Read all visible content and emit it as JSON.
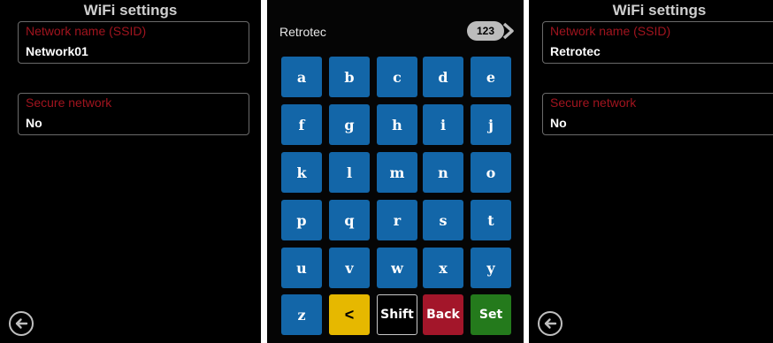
{
  "colors": {
    "panel_bg": "#000000",
    "label_red": "#a0141e",
    "key_blue": "#1366a8",
    "key_yellow": "#e6b800",
    "key_red": "#a3162a",
    "key_green": "#247a1c"
  },
  "left_screen": {
    "title": "WiFi settings",
    "ssid_label": "Network name (SSID)",
    "ssid_value": "Network01",
    "secure_label": "Secure network",
    "secure_value": "No",
    "back_icon": "arrow-left-circle-icon"
  },
  "keyboard_screen": {
    "entry_text": "Retrotec",
    "mode_toggle_label": "123",
    "mode_toggle_icon": "chevron-right-icon",
    "rows": [
      [
        "a",
        "b",
        "c",
        "d",
        "e"
      ],
      [
        "f",
        "g",
        "h",
        "i",
        "j"
      ],
      [
        "k",
        "l",
        "m",
        "n",
        "o"
      ],
      [
        "p",
        "q",
        "r",
        "s",
        "t"
      ],
      [
        "u",
        "v",
        "w",
        "x",
        "y"
      ]
    ],
    "bottom_row": {
      "z": "z",
      "backspace": "<",
      "shift": "Shift",
      "back": "Back",
      "set": "Set"
    }
  },
  "right_screen": {
    "title": "WiFi settings",
    "ssid_label": "Network name (SSID)",
    "ssid_value": "Retrotec",
    "secure_label": "Secure network",
    "secure_value": "No",
    "back_icon": "arrow-left-circle-icon"
  }
}
